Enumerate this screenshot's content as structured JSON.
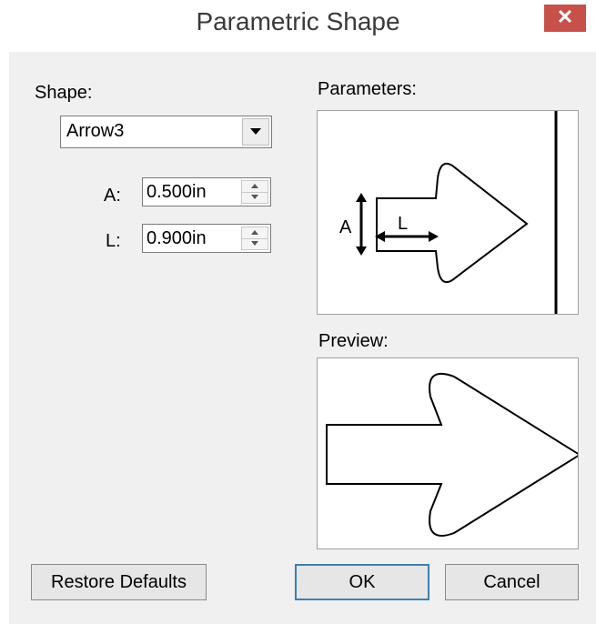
{
  "window": {
    "title": "Parametric Shape",
    "close_glyph": "✕"
  },
  "shape": {
    "label": "Shape:",
    "selected": "Arrow3"
  },
  "params": [
    {
      "label": "A:",
      "value": "0.500in"
    },
    {
      "label": "L:",
      "value": "0.900in"
    }
  ],
  "parameters_panel": {
    "label": "Parameters:",
    "dim_a": "A",
    "dim_l": "L"
  },
  "preview_panel": {
    "label": "Preview:"
  },
  "buttons": {
    "restore": "Restore Defaults",
    "ok": "OK",
    "cancel": "Cancel"
  }
}
